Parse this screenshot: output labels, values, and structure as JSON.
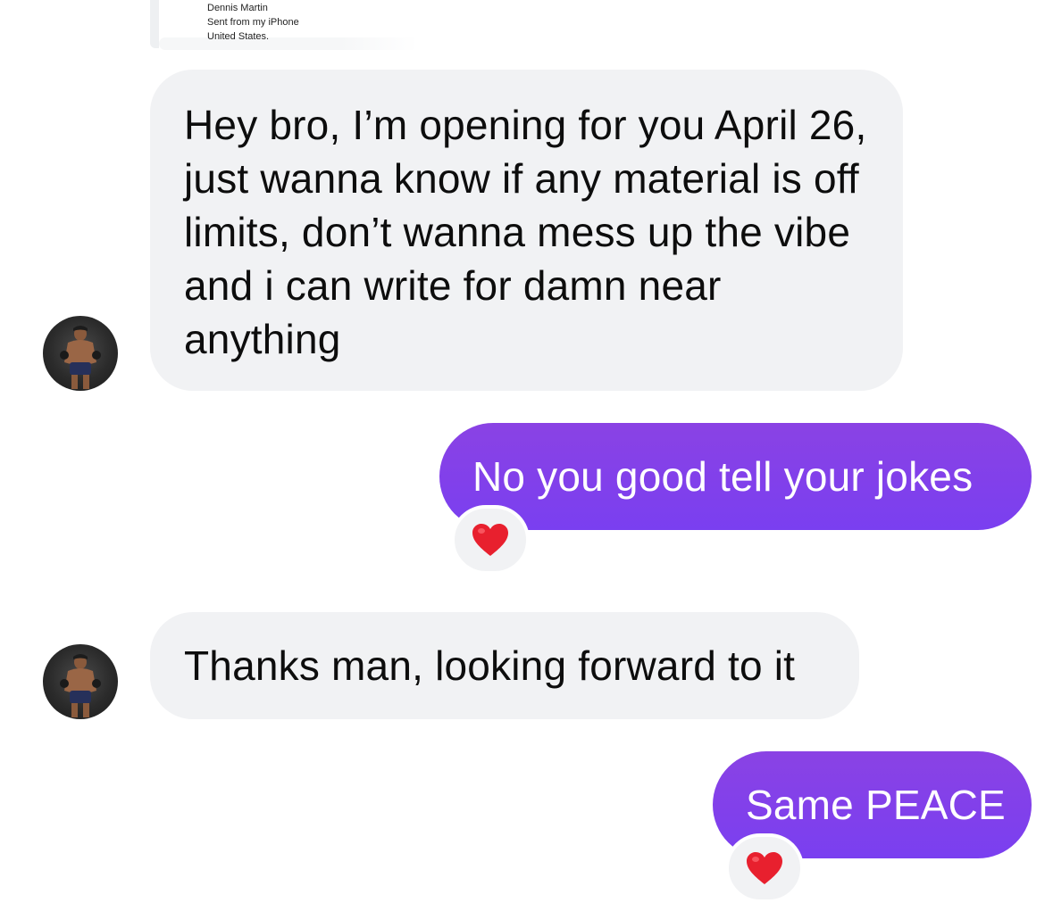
{
  "quoted_signature": {
    "lines": [
      "Dennis Martin",
      "Sent from my iPhone",
      "United States."
    ]
  },
  "messages": [
    {
      "direction": "incoming",
      "text": "Hey bro, I’m opening for you April 26, just wanna know if any material is off limits, don’t wanna mess up the vibe and i can write for damn near anything"
    },
    {
      "direction": "outgoing",
      "text": "No you good tell your jokes",
      "reaction": "heart-icon"
    },
    {
      "direction": "incoming",
      "text": "Thanks man, looking forward to it"
    },
    {
      "direction": "outgoing",
      "text": "Same PEACE",
      "reaction": "heart-icon"
    }
  ],
  "colors": {
    "incoming_bubble": "#f1f2f4",
    "outgoing_bubble": "#7f3ff0",
    "heart": "#e8202e"
  }
}
